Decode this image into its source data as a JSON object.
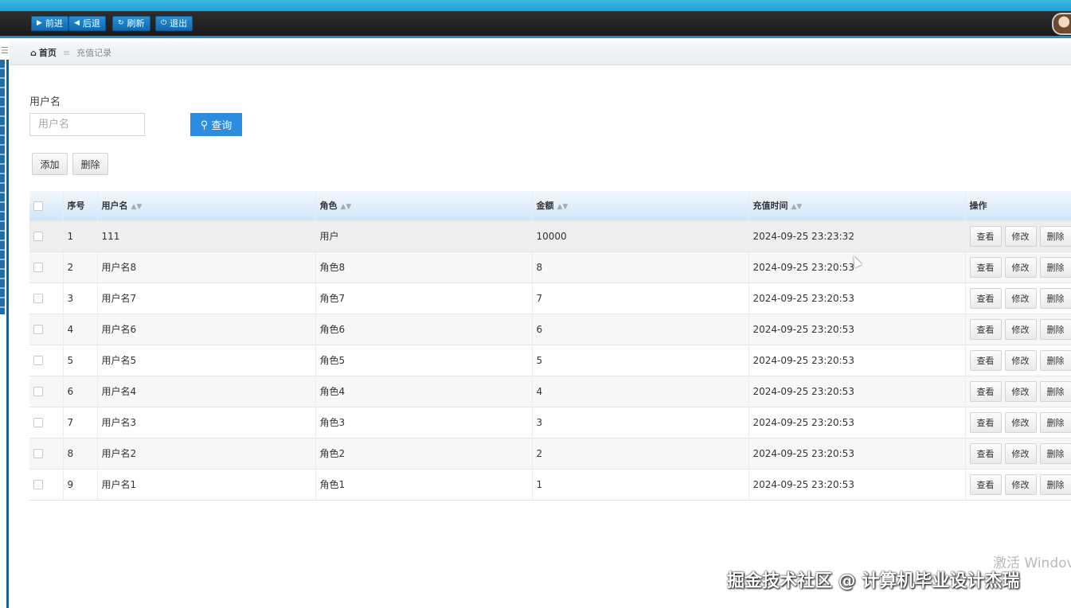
{
  "navbar": {
    "buttons": [
      {
        "icon": "play-icon",
        "label": "前进"
      },
      {
        "icon": "back-icon",
        "label": "后退"
      },
      {
        "icon": "refresh-icon",
        "label": "刷新"
      },
      {
        "icon": "power-icon",
        "label": "退出"
      }
    ]
  },
  "breadcrumb": {
    "home": "首页",
    "current": "充值记录"
  },
  "search": {
    "label": "用户名",
    "placeholder": "用户名",
    "value": "",
    "query_label": "查询"
  },
  "toolbar": {
    "add_label": "添加",
    "delete_label": "删除"
  },
  "table": {
    "columns": [
      "",
      "序号",
      "用户名",
      "角色",
      "金额",
      "充值时间",
      "操作"
    ],
    "rows": [
      [
        "1",
        "111",
        "用户",
        "10000",
        "2024-09-25 23:23:32"
      ],
      [
        "2",
        "用户名8",
        "角色8",
        "8",
        "2024-09-25 23:20:53"
      ],
      [
        "3",
        "用户名7",
        "角色7",
        "7",
        "2024-09-25 23:20:53"
      ],
      [
        "4",
        "用户名6",
        "角色6",
        "6",
        "2024-09-25 23:20:53"
      ],
      [
        "5",
        "用户名5",
        "角色5",
        "5",
        "2024-09-25 23:20:53"
      ],
      [
        "6",
        "用户名4",
        "角色4",
        "4",
        "2024-09-25 23:20:53"
      ],
      [
        "7",
        "用户名3",
        "角色3",
        "3",
        "2024-09-25 23:20:53"
      ],
      [
        "8",
        "用户名2",
        "角色2",
        "2",
        "2024-09-25 23:20:53"
      ],
      [
        "9",
        "用户名1",
        "角色1",
        "1",
        "2024-09-25 23:20:53"
      ]
    ],
    "row_actions": [
      "查看",
      "修改",
      "删除"
    ]
  },
  "overlay": {
    "windows_activation": "激活 Windov",
    "watermark": "掘金技术社区 @ 计算机毕业设计杰瑞"
  },
  "colors": {
    "accent": "#2c8ce0",
    "navbar": "#1f1f1f",
    "header_strip": "#2aa9dd"
  }
}
